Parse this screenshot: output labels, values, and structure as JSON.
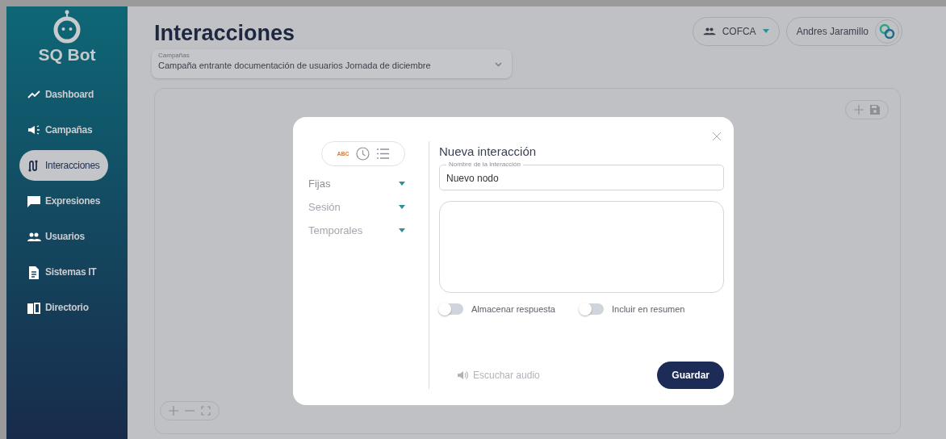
{
  "sidebar": {
    "brand": "SQ Bot",
    "items": [
      {
        "label": "Dashboard",
        "selected": false
      },
      {
        "label": "Campañas",
        "selected": false
      },
      {
        "label": "Interacciones",
        "selected": true
      },
      {
        "label": "Expresiones",
        "selected": false
      },
      {
        "label": "Usuarios",
        "selected": false
      },
      {
        "label": "Sistemas IT",
        "selected": false
      },
      {
        "label": "Directorio",
        "selected": false
      }
    ]
  },
  "header": {
    "title": "Interacciones",
    "team": "COFCA",
    "user": "Andres Jaramillo"
  },
  "campaign_select": {
    "label": "Campañas",
    "value": "Campaña entrante documentación de usuarios Jornada de diciembre"
  },
  "modal": {
    "title": "Nueva interacción",
    "type_picker": {
      "text_label": "ABC"
    },
    "variable_groups": [
      {
        "label": "Fijas"
      },
      {
        "label": "Sesión"
      },
      {
        "label": "Temporales"
      }
    ],
    "name_field": {
      "label": "Nombre de la interacción",
      "value": "Nuevo nodo"
    },
    "toggles": [
      {
        "label": "Almacenar respuesta",
        "on": false
      },
      {
        "label": "Incluir en resumen",
        "on": false
      }
    ],
    "audio_button": "Escuchar audio",
    "save_button": "Guardar"
  }
}
